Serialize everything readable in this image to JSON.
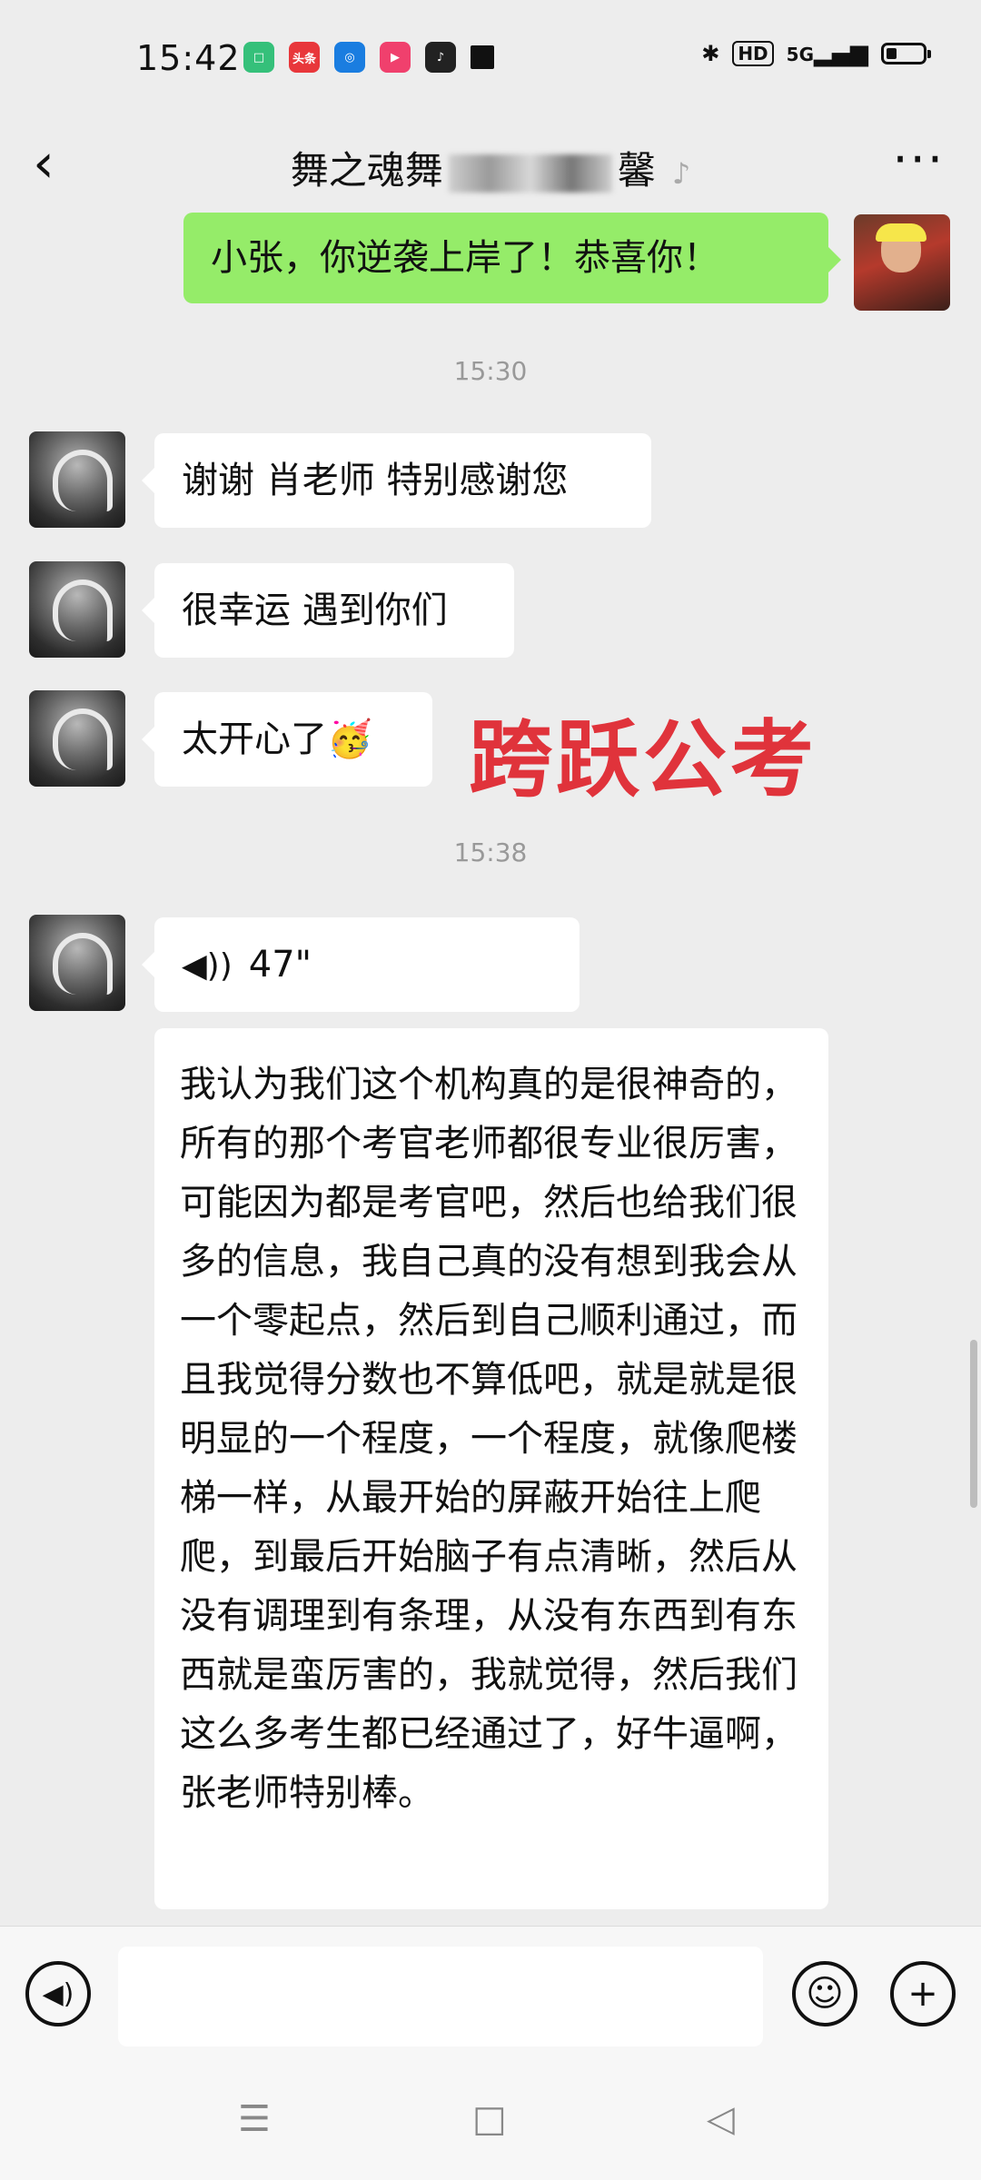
{
  "status": {
    "time": "15:42",
    "apps": [
      {
        "name": "app-icon-green",
        "color": "#35c07a",
        "label": ""
      },
      {
        "name": "toutiao-icon",
        "color": "#e8373b",
        "label": "头条"
      },
      {
        "name": "app-icon-blue",
        "color": "#1a7de0",
        "label": ""
      },
      {
        "name": "video-play-icon",
        "color": "#f0406d",
        "label": "▶"
      },
      {
        "name": "tiktok-icon",
        "color": "#222222",
        "label": "♪"
      },
      {
        "name": "app-icon-black",
        "color": "#111111",
        "label": ""
      }
    ],
    "hd": "HD",
    "network": "5G",
    "battery_level": 0.3
  },
  "header": {
    "back_glyph": "‹",
    "title_start": "舞之魂舞",
    "title_end": "馨",
    "more_glyph": "···"
  },
  "messages": {
    "m1": "小张，你逆袭上岸了！恭喜你！",
    "ts1": "15:30",
    "m2": "谢谢 肖老师 特别感谢您",
    "m3": "很幸运 遇到你们",
    "m4": "太开心了",
    "m4_emoji": "🥳",
    "ts2": "15:38",
    "voice_duration": "47\"",
    "transcript": "我认为我们这个机构真的是很神奇的，所有的那个考官老师都很专业很厉害，可能因为都是考官吧，然后也给我们很多的信息，我自己真的没有想到我会从一个零起点，然后到自己顺利通过，而且我觉得分数也不算低吧，就是就是很明显的一个程度，一个程度，就像爬楼梯一样，从最开始的屏蔽开始往上爬爬，到最后开始脑子有点清晰，然后从没有调理到有条理，从没有东西到有东西就是蛮厉害的，我就觉得，然后我们这么多考生都已经通过了，好牛逼啊，张老师特别棒。"
  },
  "overlay_text": "跨跃公考",
  "colors": {
    "sent_bubble": "#95ec69",
    "received_bubble": "#ffffff",
    "overlay": "#e0333b"
  }
}
